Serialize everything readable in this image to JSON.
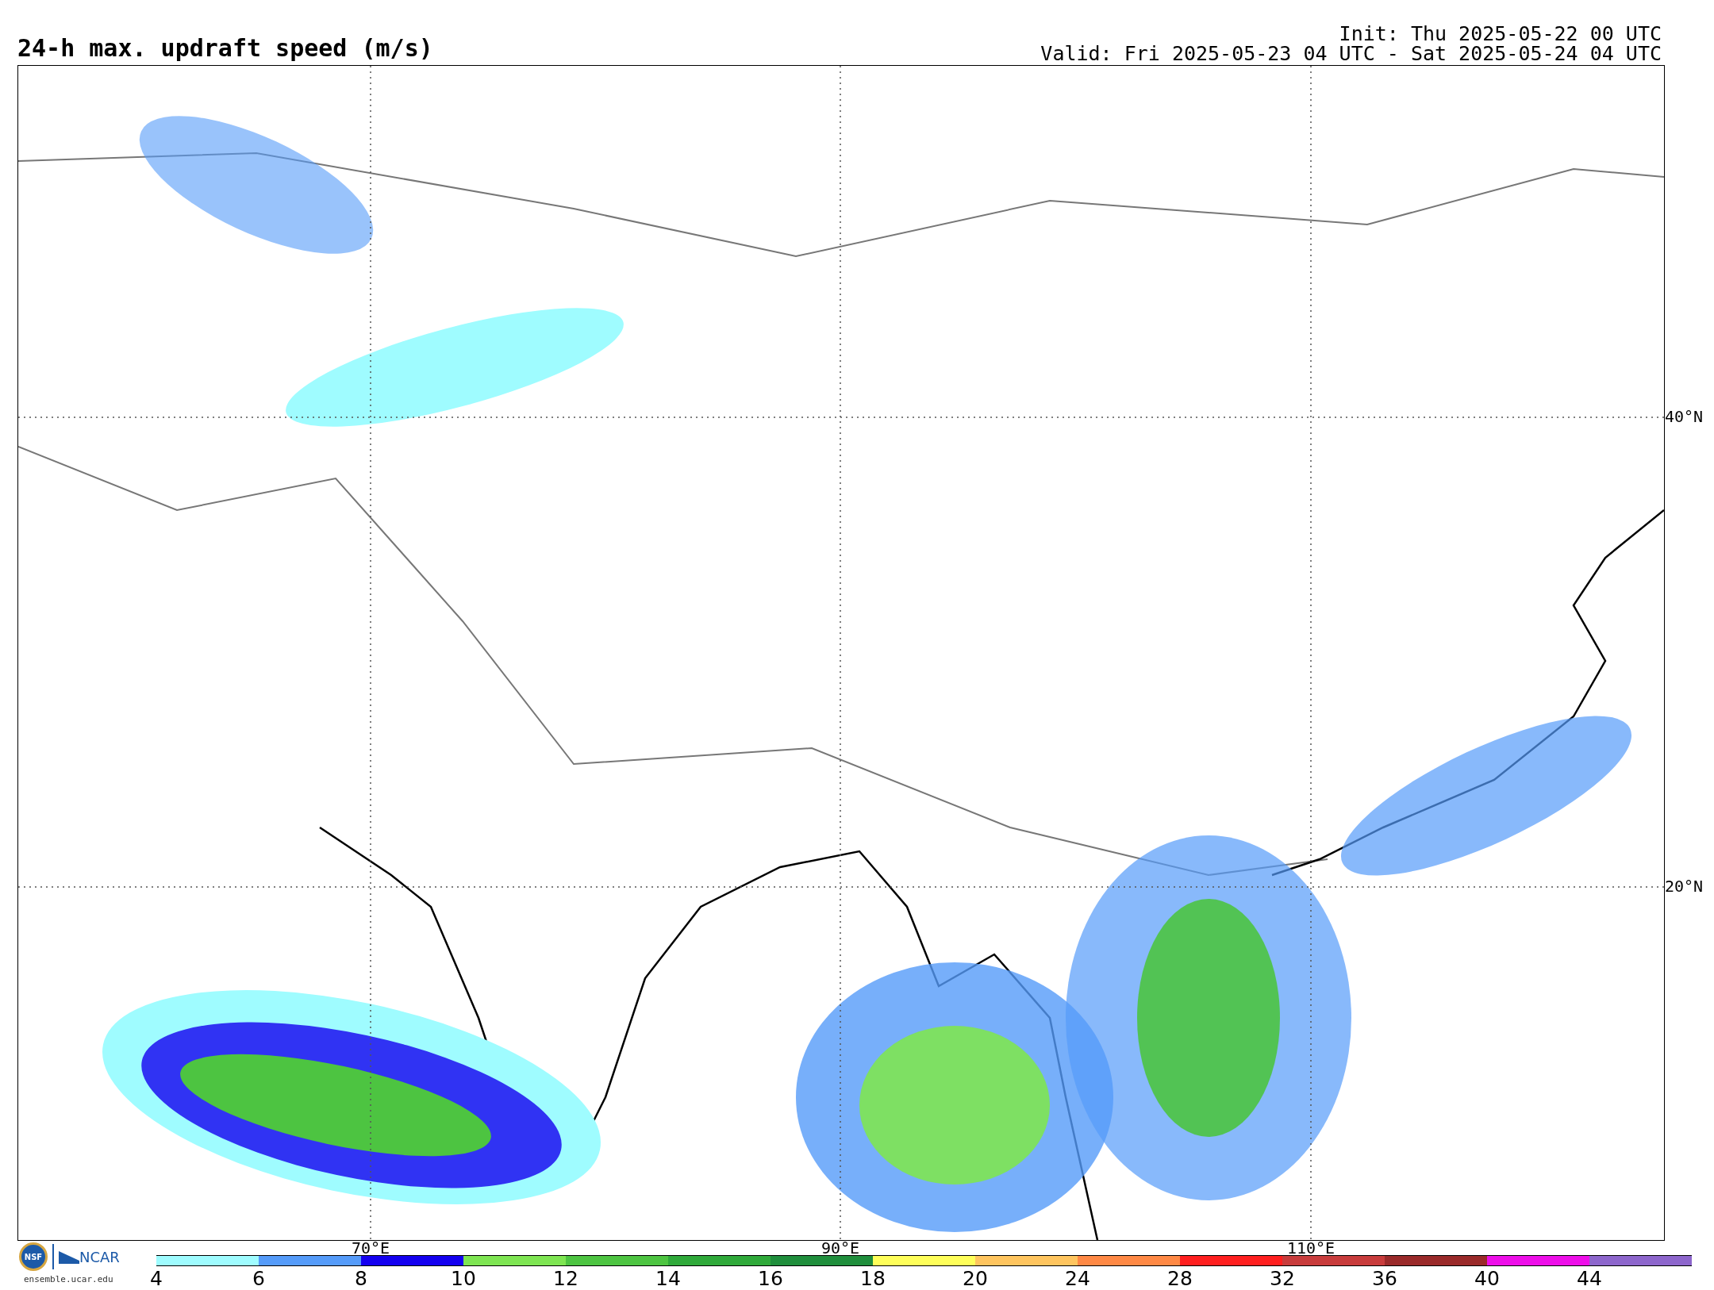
{
  "title": "24-h max. updraft speed (m/s)",
  "init": "Init: Thu 2025-05-22 00 UTC",
  "valid": "Valid: Fri 2025-05-23 04 UTC - Sat 2025-05-24 04 UTC",
  "map": {
    "lon_labels": [
      "70°E",
      "90°E",
      "110°E"
    ],
    "lat_labels": [
      "40°N",
      "20°N"
    ]
  },
  "colorbar": {
    "bins": [
      {
        "label": "4",
        "color": "#9ffcff"
      },
      {
        "label": "6",
        "color": "#559bf9"
      },
      {
        "label": "8",
        "color": "#1400f0"
      },
      {
        "label": "10",
        "color": "#7ee552"
      },
      {
        "label": "12",
        "color": "#4dc441"
      },
      {
        "label": "14",
        "color": "#2fa93a"
      },
      {
        "label": "16",
        "color": "#1f8e3c"
      },
      {
        "label": "18",
        "color": "#ffff5a"
      },
      {
        "label": "20",
        "color": "#ffc55f"
      },
      {
        "label": "24",
        "color": "#ff8945"
      },
      {
        "label": "28",
        "color": "#ff1f1f"
      },
      {
        "label": "32",
        "color": "#c83c3c"
      },
      {
        "label": "36",
        "color": "#9a2a2a"
      },
      {
        "label": "40",
        "color": "#ee0ee9"
      },
      {
        "label": "44",
        "color": "#8d66cc"
      }
    ]
  },
  "logos": {
    "nsf": "NSF",
    "ncar": "NCAR",
    "site": "ensemble.ucar.edu"
  }
}
